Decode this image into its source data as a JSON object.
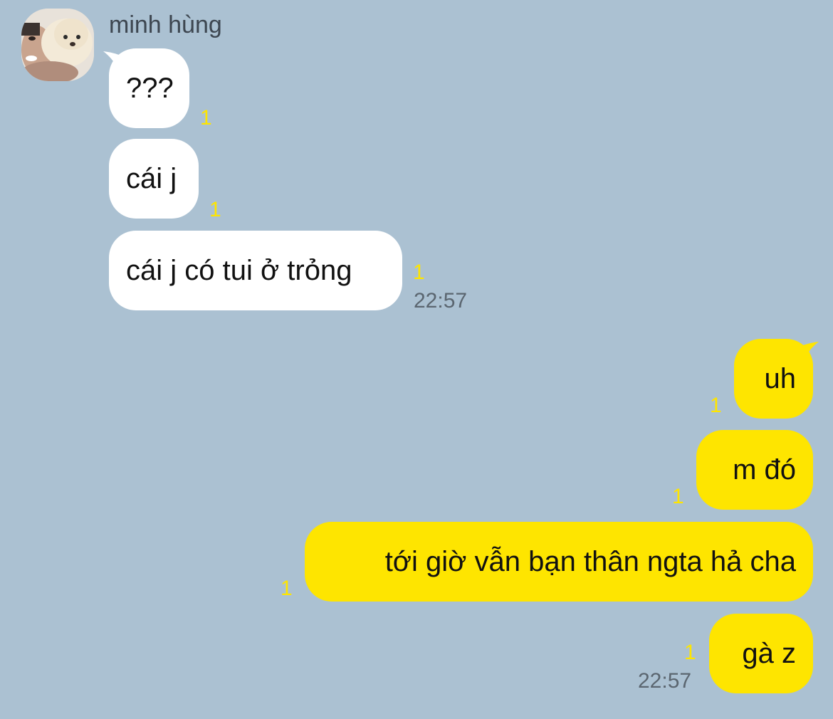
{
  "thread": {
    "incoming": {
      "sender_name": "minh hùng",
      "avatar_icon": "profile-photo-dog",
      "messages": [
        {
          "text": "???",
          "unread": "1"
        },
        {
          "text": "cái j",
          "unread": "1"
        },
        {
          "text": "cái j có tui ở trỏng",
          "unread": "1"
        }
      ],
      "time": "22:57"
    },
    "outgoing": {
      "messages": [
        {
          "text": "uh",
          "unread": "1"
        },
        {
          "text": "m đó",
          "unread": "1"
        },
        {
          "text": "tới giờ vẫn bạn thân ngta hả cha",
          "unread": "1"
        },
        {
          "text": "gà z",
          "unread": "1"
        }
      ],
      "time": "22:57"
    }
  },
  "colors": {
    "background": "#abc1d2",
    "incoming_bubble": "#ffffff",
    "outgoing_bubble": "#fee500",
    "unread_count": "#fee500",
    "timestamp": "#5b6670"
  }
}
